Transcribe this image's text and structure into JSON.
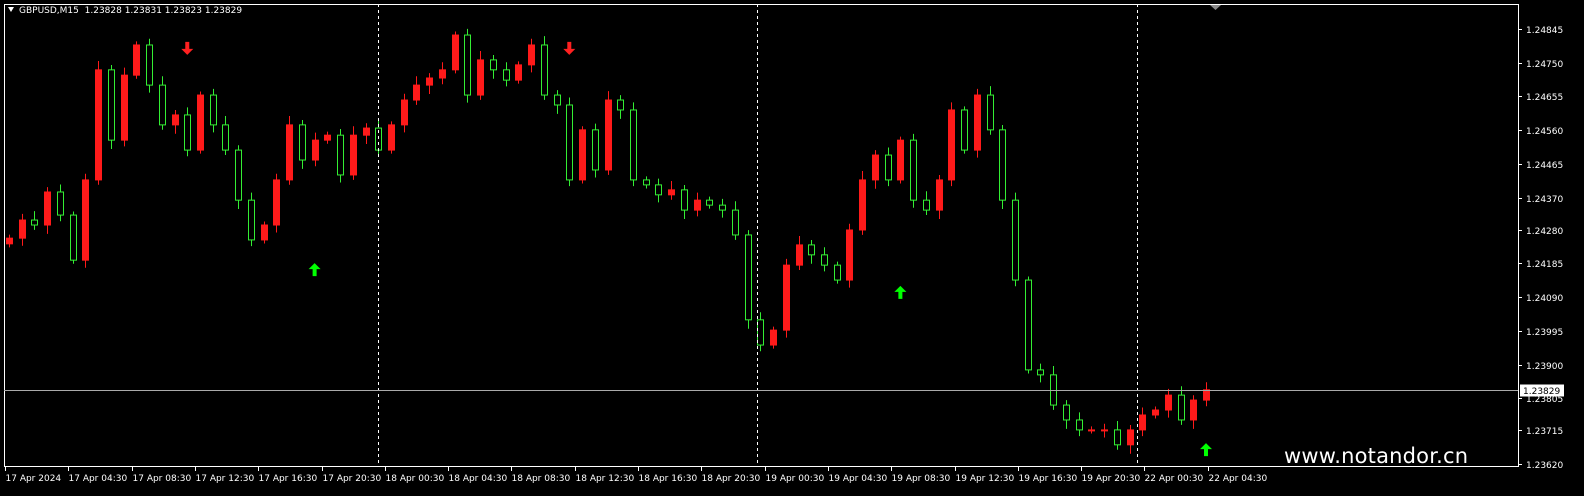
{
  "header": {
    "symbol": "GBPUSD,M15",
    "quote": "1.23828 1.23831 1.23823 1.23829"
  },
  "watermark": "www.notandor.cn",
  "colors": {
    "background": "#000000",
    "bull": "#ff1a1a",
    "bear": "#33ee33",
    "grid": "#ffffff",
    "bid_line": "#aaaaaa",
    "signal_up": "#00ff00",
    "signal_down": "#ff2020"
  },
  "chart_data": {
    "type": "candlestick",
    "title": "GBPUSD,M15",
    "ylim": [
      1.236,
      1.249
    ],
    "y_ticks": [
      "1.24845",
      "1.24750",
      "1.24655",
      "1.24560",
      "1.24465",
      "1.24370",
      "1.24280",
      "1.24185",
      "1.24090",
      "1.23995",
      "1.23900",
      "1.23805",
      "1.23715",
      "1.23620"
    ],
    "x_ticks": [
      "17 Apr 2024",
      "17 Apr 04:30",
      "17 Apr 08:30",
      "17 Apr 12:30",
      "17 Apr 16:30",
      "17 Apr 20:30",
      "18 Apr 00:30",
      "18 Apr 04:30",
      "18 Apr 08:30",
      "18 Apr 12:30",
      "18 Apr 16:30",
      "18 Apr 20:30",
      "19 Apr 00:30",
      "19 Apr 04:30",
      "19 Apr 08:30",
      "19 Apr 12:30",
      "19 Apr 16:30",
      "19 Apr 20:30",
      "22 Apr 00:30",
      "22 Apr 04:30"
    ],
    "day_separators_after_tick": [
      5,
      11,
      17
    ],
    "bid_price": "1.23829",
    "first_open": 1.2424,
    "closes": [
      1.24256,
      1.24307,
      1.24293,
      1.24386,
      1.24321,
      1.24194,
      1.2442,
      1.2473,
      1.24532,
      1.24715,
      1.248,
      1.24687,
      1.24575,
      1.24603,
      1.24504,
      1.24659,
      1.24575,
      1.24504,
      1.24363,
      1.24251,
      1.24293,
      1.2442,
      1.24575,
      1.24476,
      1.24532,
      1.24546,
      1.24434,
      1.24546,
      1.24566,
      1.24504,
      1.24575,
      1.24645,
      1.24687,
      1.24707,
      1.2473,
      1.24828,
      1.24659,
      1.24758,
      1.2473,
      1.24701,
      1.24744,
      1.248,
      1.24659,
      1.24631,
      1.2442,
      1.24561,
      1.24448,
      1.24645,
      1.24617,
      1.2442,
      1.24406,
      1.24378,
      1.24392,
      1.24335,
      1.24363,
      1.24349,
      1.24335,
      1.24265,
      1.24026,
      1.23955,
      1.23997,
      1.2418,
      1.24237,
      1.24209,
      1.2418,
      1.24138,
      1.24279,
      1.2442,
      1.2449,
      1.2442,
      1.24532,
      1.24363,
      1.24335,
      1.2442,
      1.24617,
      1.24504,
      1.24659,
      1.24561,
      1.24363,
      1.24138,
      1.23885,
      1.23871,
      1.23786,
      1.23744,
      1.23716,
      1.23716,
      1.23716,
      1.23674,
      1.23716,
      1.23758,
      1.23772,
      1.23814,
      1.23744,
      1.238,
      1.23829
    ],
    "wick": 0.00025,
    "signals": [
      {
        "type": "down",
        "index": 14,
        "price": 1.24792
      },
      {
        "type": "up",
        "index": 24,
        "price": 1.24166
      },
      {
        "type": "down",
        "index": 44,
        "price": 1.24792
      },
      {
        "type": "up",
        "index": 70,
        "price": 1.24102
      },
      {
        "type": "up",
        "index": 94,
        "price": 1.23659
      }
    ]
  }
}
